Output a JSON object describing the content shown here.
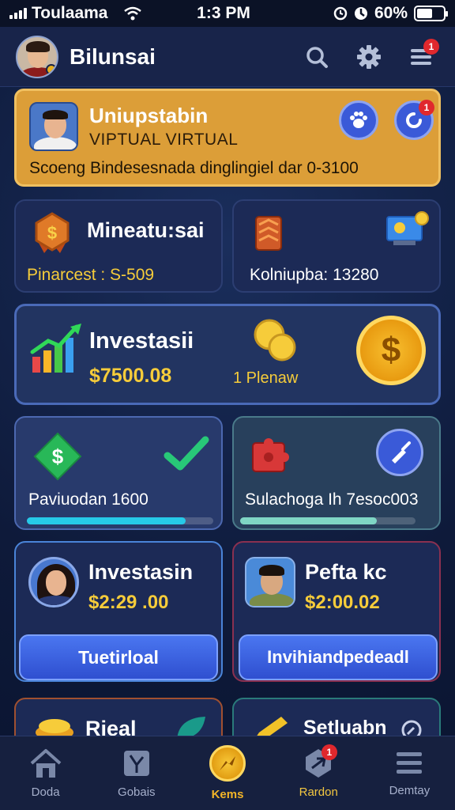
{
  "status_bar": {
    "carrier": "Toulaama",
    "time": "1:3 PM",
    "battery": "60%",
    "battery_level": 0.6
  },
  "header": {
    "username": "Bilunsai",
    "notification_count": "1",
    "icons": [
      "search-icon",
      "gear-icon",
      "menu-icon"
    ]
  },
  "banner": {
    "title": "Uniupstabin",
    "subtitle": "VIPTUAL VIRTUAL",
    "description": "Scoeng Bindesesnada dinglingiel dar 0-3100",
    "notification_count": "1",
    "colors": {
      "background": "#dc9e38",
      "border": "#f0c060"
    }
  },
  "cards": {
    "card1": {
      "title": "Mineatu:sai",
      "text": "Pinarcest : S-509"
    },
    "card2": {
      "text": "Kolniupba: 13280"
    },
    "invest": {
      "title": "Investasii",
      "value": "$7500.08",
      "label": "1 Plenaw"
    },
    "card4": {
      "text": "Paviuodan 1600",
      "progress": 0.85,
      "color": "#26c9e8"
    },
    "card5": {
      "text": "Sulachoga Ih 7esoc003",
      "progress": 0.78,
      "color": "#7fd6c4"
    },
    "card6": {
      "title": "Investasin",
      "value": "$2:29 .00",
      "button": "Tuetirloal"
    },
    "card7": {
      "title": "Pefta kc",
      "value": "$2:00.02",
      "button": "Invihiandpedeadl"
    },
    "card8": {
      "title": "Rieal"
    },
    "card9": {
      "title": "Setluabn"
    }
  },
  "bottom_nav": {
    "items": [
      {
        "label": "Doda",
        "icon": "home-icon"
      },
      {
        "label": "Gobais",
        "icon": "map-icon"
      },
      {
        "label": "Kems",
        "icon": "coin-icon"
      },
      {
        "label": "Rardon",
        "icon": "plane-icon",
        "badge": "1"
      },
      {
        "label": "Demtay",
        "icon": "menu-icon"
      }
    ],
    "active_color": "#f2b428"
  }
}
